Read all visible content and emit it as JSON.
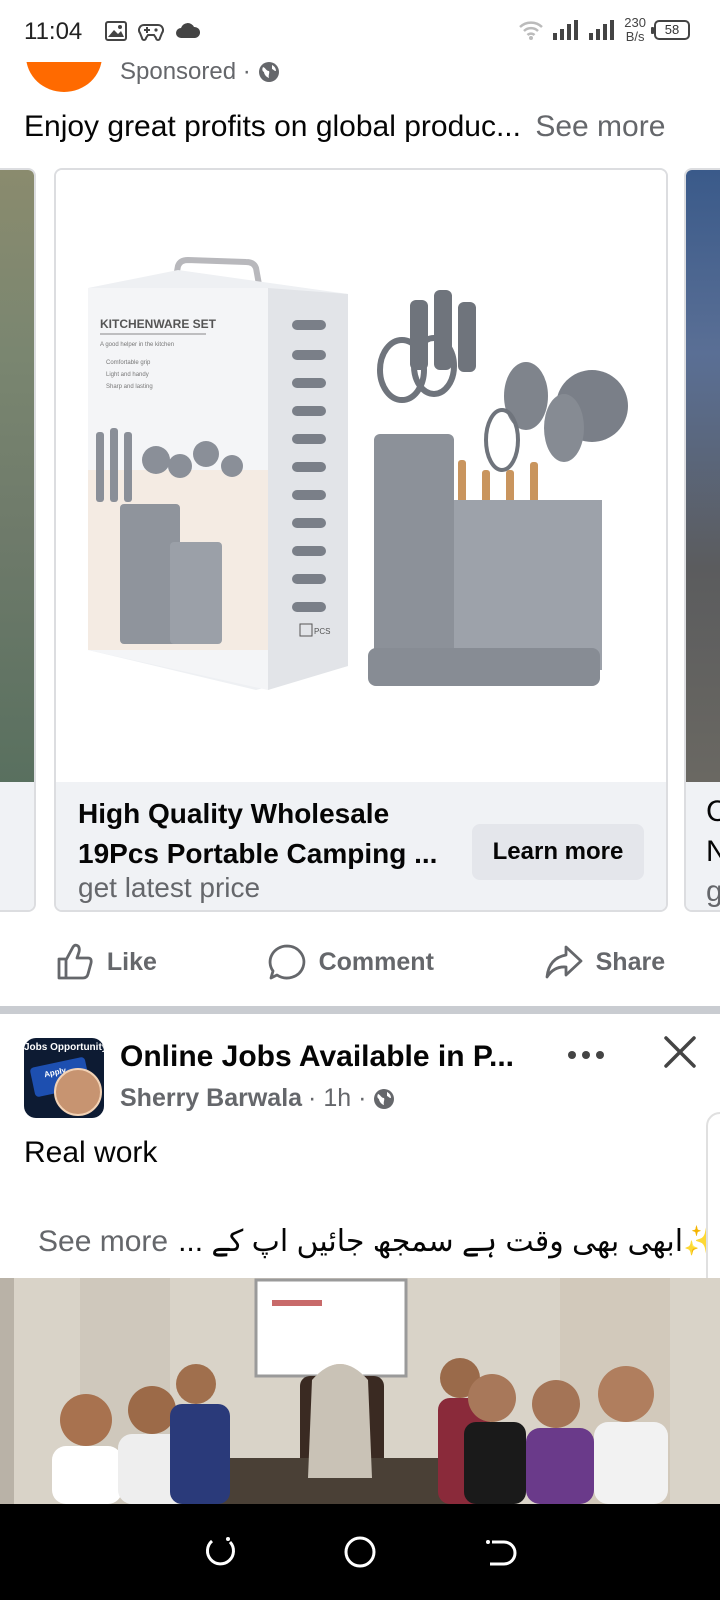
{
  "status_bar": {
    "time": "11:04",
    "net_speed_value": "230",
    "net_speed_unit": "B/s",
    "battery": "58",
    "icons": [
      "gallery-icon",
      "game-controller-icon",
      "cloud-icon",
      "wifi-icon",
      "signal-icon",
      "signal-icon"
    ]
  },
  "ad_post": {
    "sponsored_label": "Sponsored · ",
    "text": "Enjoy great profits on global produc...",
    "see_more": "See more",
    "carousel": {
      "main_card": {
        "title_line1": "High Quality Wholesale",
        "title_line2": "19Pcs Portable Camping ...",
        "subtitle": "get latest price",
        "cta": "Learn more",
        "box_title": "KITCHENWARE SET",
        "box_tagline": "A good helper in the kitchen",
        "box_bullets": [
          "Comfortable grip",
          "Light and handy",
          "Sharp and lasting"
        ],
        "box_pcs": "PCS"
      },
      "next_card_peek": [
        "C",
        "N",
        "g"
      ]
    },
    "actions": {
      "like": "Like",
      "comment": "Comment",
      "share": "Share"
    }
  },
  "post": {
    "avatar_tag": "Jobs Opportunity",
    "avatar_button": "Apply",
    "title": "Online Jobs Available in P...",
    "author": "Sherry Barwala",
    "time": "· 1h ·",
    "text": "Real work",
    "urdu_text": "✨ابھی بھی وقت ہے سمجھ جائیں اپ کے ...",
    "see_more": "See more"
  },
  "colors": {
    "secondary_text": "#65676b",
    "card_footer": "#f0f2f5",
    "button_bg": "#e4e6eb",
    "ad_avatar": "#ff6a00",
    "nav_bar": "#000000"
  }
}
